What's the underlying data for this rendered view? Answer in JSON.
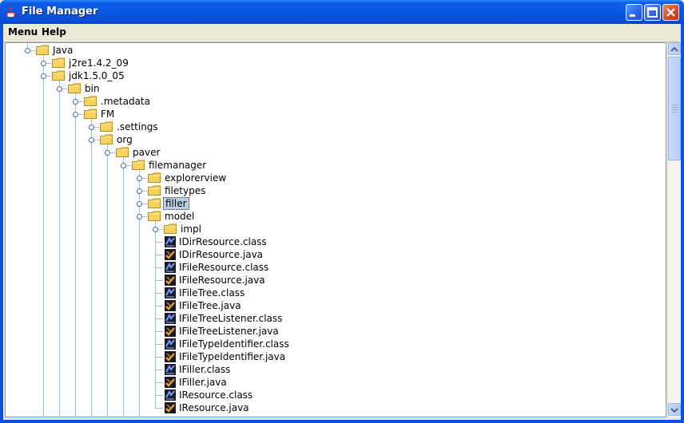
{
  "window": {
    "title": "File Manager"
  },
  "menubar": {
    "items": [
      "Menu",
      "Help"
    ]
  },
  "tree": {
    "nodes": [
      {
        "label": "Java",
        "depth": 0,
        "kind": "folder",
        "expanded": true
      },
      {
        "label": "j2re1.4.2_09",
        "depth": 1,
        "kind": "folder",
        "expanded": false
      },
      {
        "label": "jdk1.5.0_05",
        "depth": 1,
        "kind": "folder",
        "expanded": true
      },
      {
        "label": "bin",
        "depth": 2,
        "kind": "folder",
        "expanded": true
      },
      {
        "label": ".metadata",
        "depth": 3,
        "kind": "folder",
        "expanded": false
      },
      {
        "label": "FM",
        "depth": 3,
        "kind": "folder",
        "expanded": true
      },
      {
        "label": ".settings",
        "depth": 4,
        "kind": "folder",
        "expanded": false
      },
      {
        "label": "org",
        "depth": 4,
        "kind": "folder",
        "expanded": true
      },
      {
        "label": "paver",
        "depth": 5,
        "kind": "folder",
        "expanded": true
      },
      {
        "label": "filemanager",
        "depth": 6,
        "kind": "folder",
        "expanded": true
      },
      {
        "label": "explorerview",
        "depth": 7,
        "kind": "folder",
        "expanded": false
      },
      {
        "label": "filetypes",
        "depth": 7,
        "kind": "folder",
        "expanded": false
      },
      {
        "label": "filler",
        "depth": 7,
        "kind": "folder",
        "expanded": false,
        "selected": true
      },
      {
        "label": "model",
        "depth": 7,
        "kind": "folder",
        "expanded": true
      },
      {
        "label": "impl",
        "depth": 8,
        "kind": "folder",
        "expanded": false
      },
      {
        "label": "IDirResource.class",
        "depth": 8,
        "kind": "class"
      },
      {
        "label": "IDirResource.java",
        "depth": 8,
        "kind": "java"
      },
      {
        "label": "IFileResource.class",
        "depth": 8,
        "kind": "class"
      },
      {
        "label": "IFileResource.java",
        "depth": 8,
        "kind": "java"
      },
      {
        "label": "IFileTree.class",
        "depth": 8,
        "kind": "class"
      },
      {
        "label": "IFileTree.java",
        "depth": 8,
        "kind": "java"
      },
      {
        "label": "IFileTreeListener.class",
        "depth": 8,
        "kind": "class"
      },
      {
        "label": "IFileTreeListener.java",
        "depth": 8,
        "kind": "java"
      },
      {
        "label": "IFileTypeIdentifier.class",
        "depth": 8,
        "kind": "class"
      },
      {
        "label": "IFileTypeIdentifier.java",
        "depth": 8,
        "kind": "java"
      },
      {
        "label": "IFiller.class",
        "depth": 8,
        "kind": "class"
      },
      {
        "label": "IFiller.java",
        "depth": 8,
        "kind": "java"
      },
      {
        "label": "IResource.class",
        "depth": 8,
        "kind": "class"
      },
      {
        "label": "IResource.java",
        "depth": 8,
        "kind": "java"
      }
    ]
  },
  "colors": {
    "titlebar": "#0a55dd",
    "folder": "#f5d35c",
    "selection": "#b8cfe5",
    "tree_line": "#a8bccf"
  },
  "icons": {
    "folder": "folder-icon",
    "class": "class-file-icon",
    "java": "java-file-icon"
  }
}
